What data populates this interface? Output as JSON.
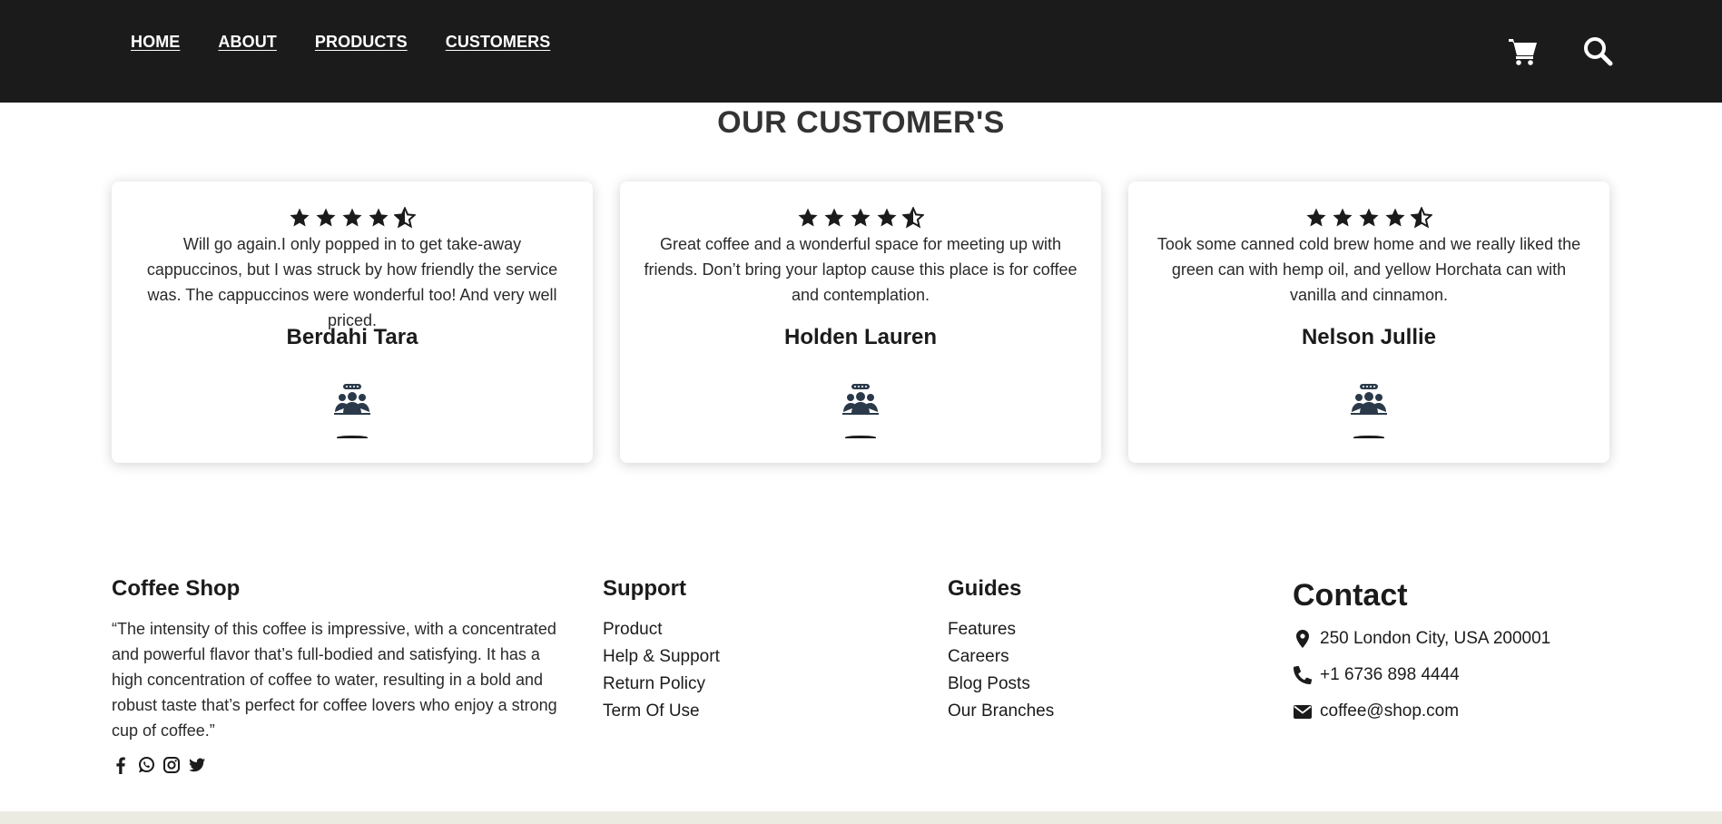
{
  "header": {
    "nav": [
      "HOME",
      "ABOUT",
      "PRODUCTS",
      "CUSTOMERS"
    ],
    "icons": [
      "cart-icon",
      "search-icon"
    ],
    "background": "#1b1b1b"
  },
  "customers_section": {
    "title": "OUR CUSTOMER'S",
    "rating": 4.5,
    "reviews": [
      {
        "text": "Will go again.I only popped in to get take-away cappuccinos, but I was struck by how friendly the service was. The cappuccinos were wonderful too! And very well priced.",
        "name": "Berdahi Tara"
      },
      {
        "text": "Great coffee and a wonderful space for meeting up with friends. Don’t bring your laptop cause this place is for coffee and contemplation.",
        "name": "Holden Lauren"
      },
      {
        "text": "Took some canned cold brew home and we really liked the green can with hemp oil, and yellow Horchata can with vanilla and cinnamon.",
        "name": "Nelson Jullie"
      }
    ]
  },
  "footer": {
    "about": {
      "title": "Coffee Shop",
      "text": "“The intensity of this coffee is impressive, with a concentrated and powerful flavor that’s full-bodied and satisfying. It has a high concentration of coffee to water, resulting in a bold and robust taste that’s perfect for coffee lovers who enjoy a strong cup of coffee.”",
      "socials": [
        "facebook-icon",
        "whatsapp-icon",
        "instagram-icon",
        "twitter-icon"
      ]
    },
    "support": {
      "title": "Support",
      "links": [
        "Product",
        "Help & Support",
        "Return Policy",
        "Term Of Use"
      ]
    },
    "guides": {
      "title": "Guides",
      "links": [
        "Features",
        "Careers",
        "Blog Posts",
        "Our Branches"
      ]
    },
    "contact": {
      "title": "Contact",
      "address": "250 London City, USA 200001",
      "phone": "+1 6736 898 4444",
      "email": "coffee@shop.com"
    }
  }
}
